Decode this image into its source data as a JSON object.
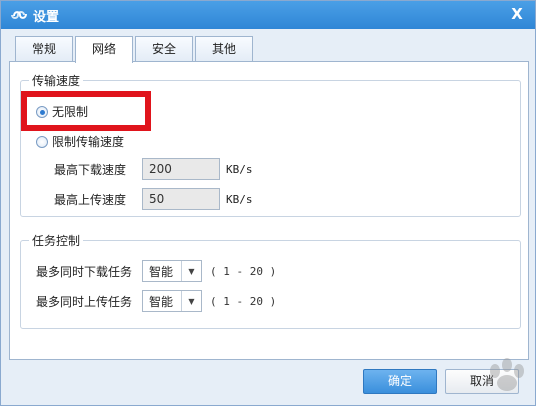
{
  "window": {
    "title": "设置",
    "close_label": "X"
  },
  "tabs": [
    {
      "label": "常规",
      "active": false
    },
    {
      "label": "网络",
      "active": true
    },
    {
      "label": "安全",
      "active": false
    },
    {
      "label": "其他",
      "active": false
    }
  ],
  "transfer_speed": {
    "legend": "传输速度",
    "unlimited_label": "无限制",
    "unlimited_selected": true,
    "limited_label": "限制传输速度",
    "limited_selected": false,
    "max_download_label": "最高下载速度",
    "max_download_value": "200",
    "max_upload_label": "最高上传速度",
    "max_upload_value": "50",
    "unit": "KB/s"
  },
  "task_control": {
    "legend": "任务控制",
    "max_download_tasks_label": "最多同时下载任务",
    "max_download_tasks_value": "智能",
    "max_upload_tasks_label": "最多同时上传任务",
    "max_upload_tasks_value": "智能",
    "range_text": "( 1 - 20 )"
  },
  "buttons": {
    "ok": "确定",
    "cancel": "取消"
  },
  "colors": {
    "titlebar": "#2f86d6",
    "highlight": "#e0141c",
    "primary_button": "#3a8fdc"
  }
}
